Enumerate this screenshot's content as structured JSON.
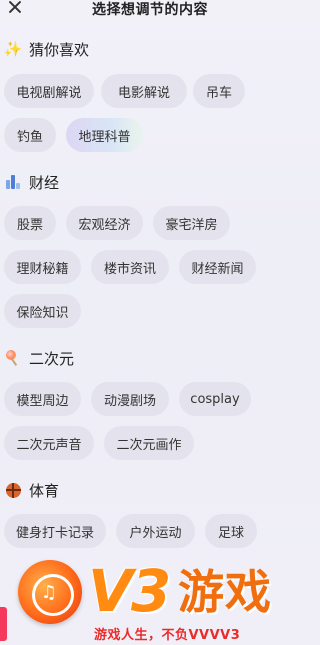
{
  "header": {
    "title": "选择想调节的内容"
  },
  "sections": [
    {
      "title": "猜你喜欢",
      "icon": "sparkle-icon",
      "chips": [
        {
          "label": "电视剧解说",
          "selected": false
        },
        {
          "label": "电影解说",
          "selected": false
        },
        {
          "label": "吊车",
          "selected": false
        },
        {
          "label": "钓鱼",
          "selected": false
        },
        {
          "label": "地理科普",
          "selected": true
        }
      ]
    },
    {
      "title": "财经",
      "icon": "building-chart-icon",
      "chips": [
        {
          "label": "股票",
          "selected": false
        },
        {
          "label": "宏观经济",
          "selected": false
        },
        {
          "label": "豪宅洋房",
          "selected": false
        },
        {
          "label": "理财秘籍",
          "selected": false
        },
        {
          "label": "楼市资讯",
          "selected": false
        },
        {
          "label": "财经新闻",
          "selected": false
        },
        {
          "label": "保险知识",
          "selected": false
        }
      ]
    },
    {
      "title": "二次元",
      "icon": "lollipop-icon",
      "chips": [
        {
          "label": "模型周边",
          "selected": false
        },
        {
          "label": "动漫剧场",
          "selected": false
        },
        {
          "label": "cosplay",
          "selected": false
        },
        {
          "label": "二次元声音",
          "selected": false
        },
        {
          "label": "二次元画作",
          "selected": false
        }
      ]
    },
    {
      "title": "体育",
      "icon": "basketball-icon",
      "chips": [
        {
          "label": "健身打卡记录",
          "selected": false
        },
        {
          "label": "户外运动",
          "selected": false
        },
        {
          "label": "足球",
          "selected": false
        }
      ]
    }
  ],
  "watermark": {
    "logo_text": "V3",
    "brand": "游戏",
    "slogan": "游戏人生，不负VVVV3"
  },
  "colors": {
    "chip_bg": "#e4e3ed",
    "selected_gradient_start": "#dcd6f3",
    "selected_gradient_end": "#eaf4ec",
    "watermark_orange": "#ff8b12",
    "slogan_red": "#ec2a2a"
  }
}
